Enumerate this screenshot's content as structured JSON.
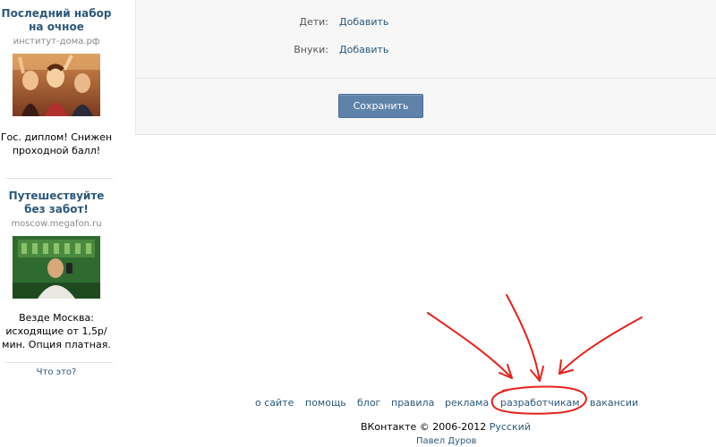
{
  "ads": [
    {
      "title": "Последний набор на очное",
      "domain": "институт-дома.рф",
      "image": "party-crowd-photo",
      "text": "Гос. диплом! Снижен проходной балл!"
    },
    {
      "title": "Путешествуйте без забот!",
      "domain": "moscow.megafon.ru",
      "image": "man-with-phone-photo",
      "text": "Везде Москва: исходящие от 1,5р/мин. Опция платная."
    }
  ],
  "ads_what_link": "Что это?",
  "form": {
    "rows": [
      {
        "label": "Дети:",
        "action": "Добавить"
      },
      {
        "label": "Внуки:",
        "action": "Добавить"
      }
    ],
    "save_label": "Сохранить"
  },
  "footer": {
    "nav": [
      "о сайте",
      "помощь",
      "блог",
      "правила",
      "реклама",
      "разработчикам",
      "вакансии"
    ],
    "copyright": "ВКонтакте © 2006-2012",
    "language": "Русский",
    "author": "Павел Дуров"
  },
  "colors": {
    "link": "#2B587A",
    "button": "#5F82A8",
    "panel": "#F7F7F7",
    "annotation": "#E8201B"
  }
}
